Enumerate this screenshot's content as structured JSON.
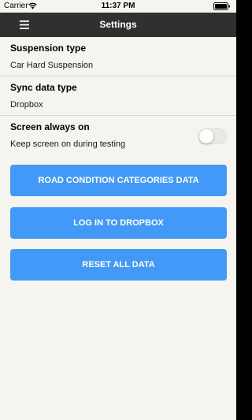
{
  "status_bar": {
    "carrier": "Carrier",
    "time": "11:37 PM",
    "wifi_icon": "wifi-icon",
    "battery_icon": "battery-icon"
  },
  "nav": {
    "title": "Settings",
    "menu_icon": "hamburger-menu-icon"
  },
  "settings": {
    "suspension": {
      "title": "Suspension type",
      "value": "Car Hard Suspension"
    },
    "sync": {
      "title": "Sync data type",
      "value": "Dropbox"
    },
    "screen": {
      "title": "Screen always on",
      "value": "Keep screen on during testing",
      "enabled": false
    }
  },
  "buttons": {
    "road_condition": "ROAD CONDITION CATEGORIES DATA",
    "dropbox_login": "LOG IN TO DROPBOX",
    "reset": "RESET ALL DATA"
  },
  "colors": {
    "nav_background": "#30302f",
    "page_background": "#f6f4ef",
    "accent": "#4399f7"
  }
}
